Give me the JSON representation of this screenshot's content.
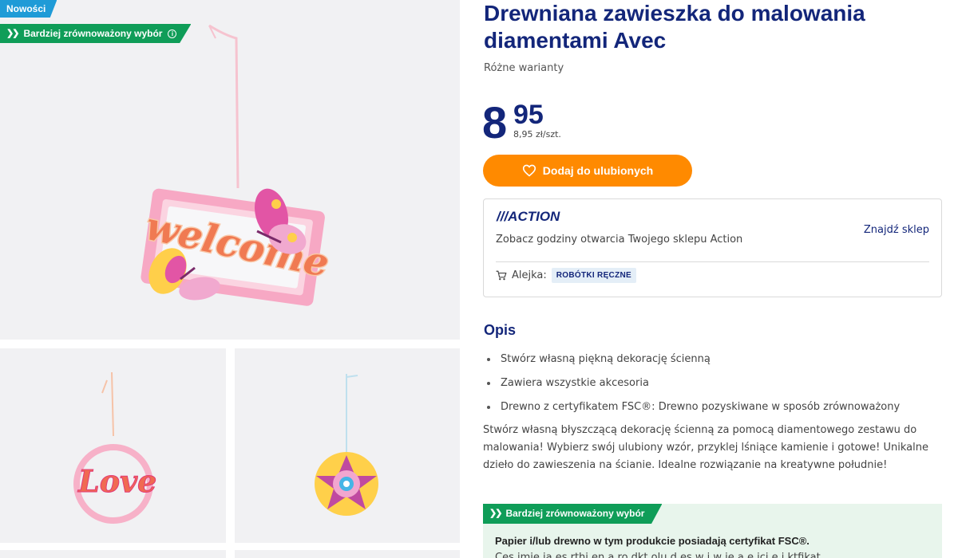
{
  "badges": {
    "new": "Nowości",
    "sustainable": "Bardziej zrównoważony wybór"
  },
  "product": {
    "title": "Drewniana zawieszka do malowania diamentami Avec",
    "variants": "Różne warianty",
    "price_main": "8",
    "price_cents": "95",
    "price_unit": "8,95 zł/szt.",
    "image_texts": {
      "main": "welcome",
      "thumb1": "Love"
    }
  },
  "actions": {
    "favorite_label": "Dodaj do ulubionych"
  },
  "store": {
    "logo": "ACTION",
    "hours_text": "Zobacz godziny otwarcia Twojego sklepu Action",
    "find_store": "Znajdź sklep",
    "aisle_label": "Alejka:",
    "aisle_value": "ROBÓTKI RĘCZNE"
  },
  "description": {
    "heading": "Opis",
    "bullets": [
      "Stwórz własną piękną dekorację ścienną",
      "Zawiera wszystkie akcesoria",
      "Drewno z certyfikatem FSC®: Drewno pozyskiwane w sposób zrównoważony"
    ],
    "paragraph": "Stwórz własną błyszczącą dekorację ścienną za pomocą diamentowego zestawu do malowania! Wybierz swój ulubiony wzór, przyklej lśniące kamienie i gotowe! Unikalne dzieło do zawieszenia na ścianie. Idealne rozwiązanie na kreatywne południe!"
  },
  "sustainability": {
    "tag": "Bardziej zrównoważony wybór",
    "heading": "Papier i/lub drewno w tym produkcie posiadają certyfikat FSC®.",
    "cut_text": "Ces imie ia es rthi en a ro dkt olu d es w i w ie a e ici e i ktfikat"
  },
  "colors": {
    "brand_blue": "#13267a",
    "accent_orange": "#ff8a00",
    "sustain_green": "#0f9d58",
    "new_badge_blue": "#1f9bd7"
  },
  "icons": {
    "favorite": "heart-icon",
    "cart": "cart-icon",
    "info": "info-icon",
    "chevrons": "double-chevron-icon"
  }
}
